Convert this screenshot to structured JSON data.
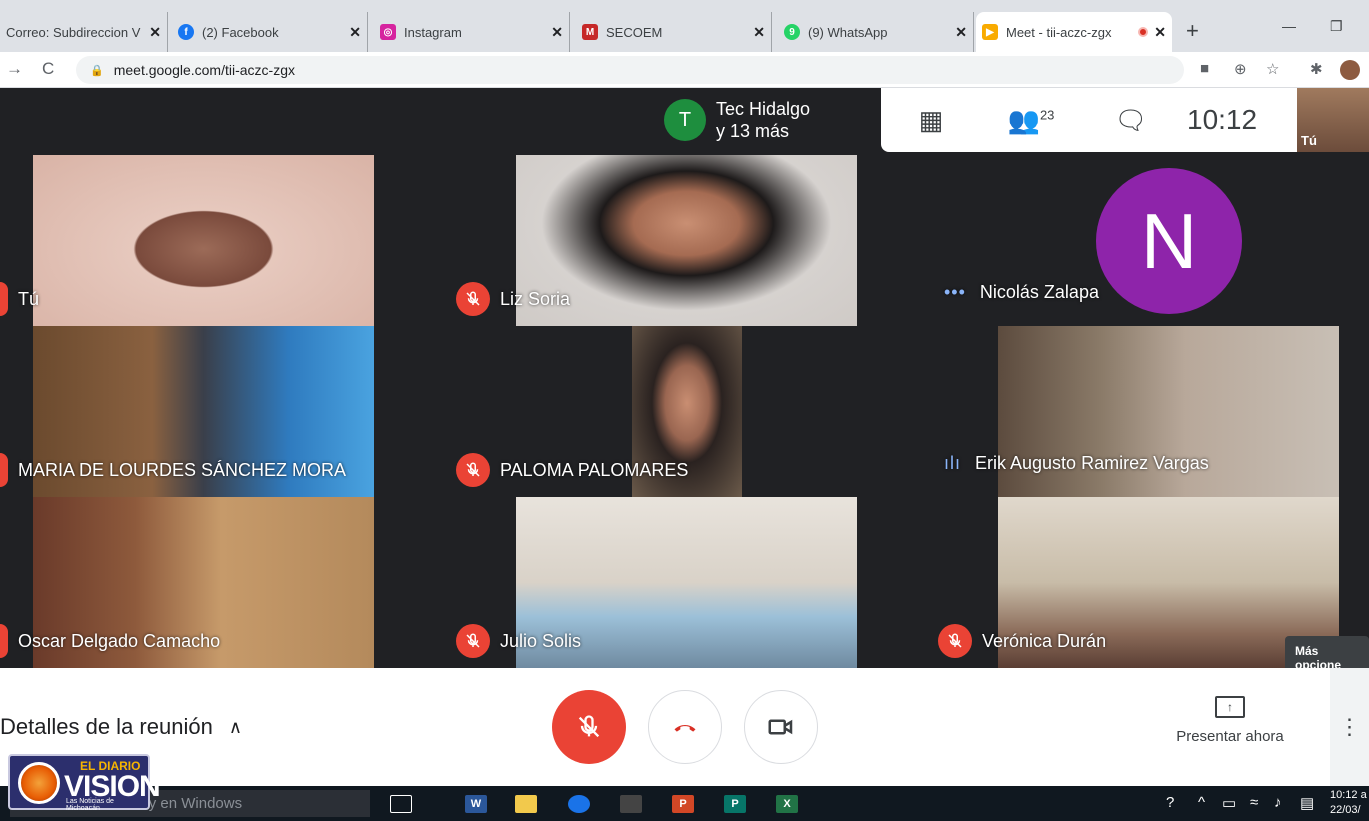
{
  "browser": {
    "tabs": [
      {
        "label": "Correo: Subdireccion V",
        "icon": "outlook-icon",
        "color": "#0078d4"
      },
      {
        "label": "(2) Facebook",
        "icon": "facebook-icon",
        "color": "#1877f2"
      },
      {
        "label": "Instagram",
        "icon": "instagram-icon",
        "color": "#d6249f"
      },
      {
        "label": "SECOEM",
        "icon": "secoem-icon",
        "color": "#c62828"
      },
      {
        "label": "(9) WhatsApp",
        "icon": "whatsapp-icon",
        "color": "#25d366"
      },
      {
        "label": "Meet - tii-aczc-zgx",
        "icon": "meet-icon",
        "color": "#f9ab00"
      }
    ],
    "url": "meet.google.com/tii-aczc-zgx"
  },
  "meet": {
    "host_avatar": "T",
    "host_name": "Tec Hidalgo",
    "host_others": "y 13 más",
    "participant_count": "23",
    "clock": "10:12",
    "self_label": "Tú",
    "participants": [
      {
        "name": "Tú",
        "status": "mic-off"
      },
      {
        "name": "Liz Soria",
        "status": "mic-off"
      },
      {
        "name": "Nicolás Zalapa",
        "status": "speaking-dots",
        "avatar": "N"
      },
      {
        "name": "MARIA DE LOURDES SÁNCHEZ MORA",
        "status": "mic-off"
      },
      {
        "name": "PALOMA PALOMARES",
        "status": "mic-off"
      },
      {
        "name": "Erik Augusto Ramirez Vargas",
        "status": "speaking-bars"
      },
      {
        "name": "Oscar Delgado Camacho",
        "status": "mic-off"
      },
      {
        "name": "Julio Solis",
        "status": "mic-off"
      },
      {
        "name": "Verónica Durán",
        "status": "mic-off"
      }
    ],
    "tooltip": "Más opcione"
  },
  "controls": {
    "details_label": "Detalles de la reunión",
    "present_label": "Presentar ahora"
  },
  "taskbar": {
    "search_placeholder": "Buscar en Internet y en Windows",
    "time": "10:12 a",
    "date": "22/03/"
  },
  "watermark": {
    "top": "EL DIARIO",
    "main": "VISION",
    "tagline": "Las Noticias de Michoacán"
  }
}
